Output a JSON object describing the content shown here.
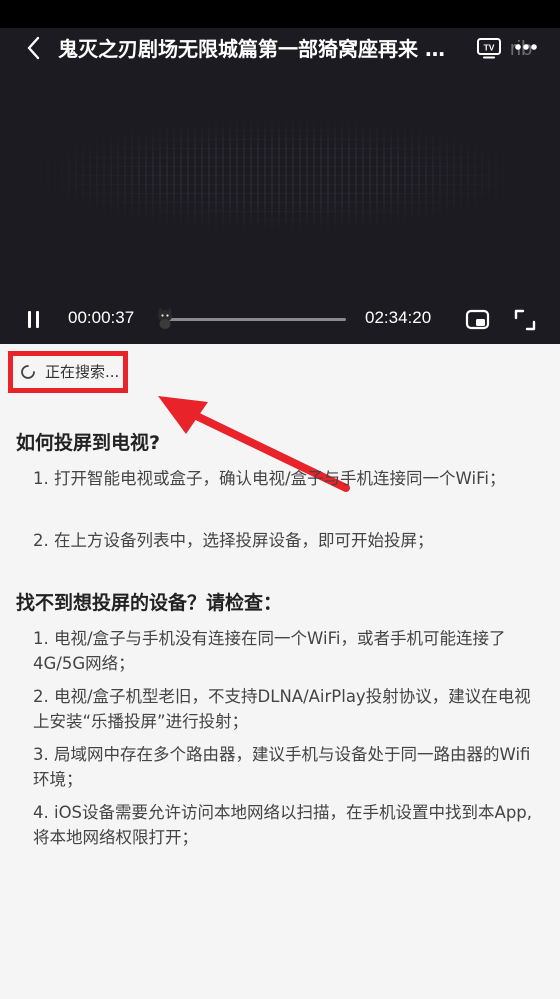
{
  "player": {
    "title": "鬼灭之刃剧场无限城篇第一部猗窝座再来 …",
    "current_time": "00:00:37",
    "total_time": "02:34:20",
    "progress_fraction": 0.004,
    "icons": {
      "back": "chevron-left-icon",
      "tv": "tv-cast-icon",
      "more": "more-dots-icon",
      "pause": "pause-icon",
      "pip": "picture-in-picture-icon",
      "fullscreen": "fullscreen-icon",
      "thumb": "cat-mascot-icon"
    },
    "more_overlay_text": "rib"
  },
  "cast": {
    "searching_text": "正在搜索...",
    "accent_color": "#e8232a",
    "how_to": {
      "heading": "如何投屏到电视?",
      "items": [
        "1. 打开智能电视或盒子，确认电视/盒子与手机连接同一个WiFi；",
        "2. 在上方设备列表中，选择投屏设备，即可开始投屏；"
      ]
    },
    "troubleshoot": {
      "heading": "找不到想投屏的设备？请检查：",
      "items": [
        "1. 电视/盒子与手机没有连接在同一个WiFi，或者手机可能连接了4G/5G网络；",
        "2. 电视/盒子机型老旧，不支持DLNA/AirPlay投射协议，建议在电视上安装“乐播投屏”进行投射；",
        "3. 局域网中存在多个路由器，建议手机与设备处于同一路由器的Wifi环境；",
        "4. iOS设备需要允许访问本地网络以扫描，在手机设置中找到本App, 将本地网络权限打开；"
      ]
    }
  }
}
